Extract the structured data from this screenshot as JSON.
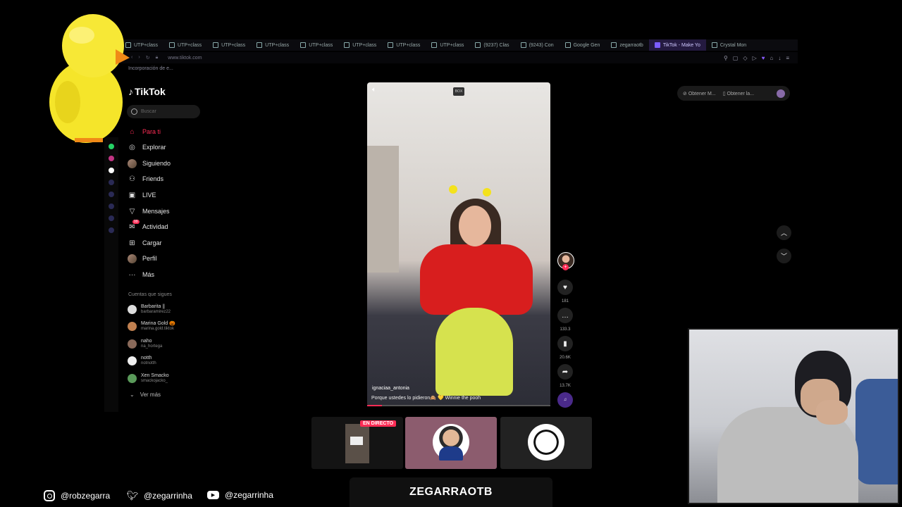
{
  "browser": {
    "tabs": [
      {
        "label": "UTP+class",
        "active": false
      },
      {
        "label": "UTP+class",
        "active": false
      },
      {
        "label": "UTP+class",
        "active": false
      },
      {
        "label": "UTP+class",
        "active": false
      },
      {
        "label": "UTP+class",
        "active": false
      },
      {
        "label": "UTP+class",
        "active": false
      },
      {
        "label": "UTP+class",
        "active": false
      },
      {
        "label": "UTP+class",
        "active": false
      },
      {
        "label": "(9237) Clas",
        "active": false
      },
      {
        "label": "(9243) Con",
        "active": false
      },
      {
        "label": "Google Gen",
        "active": false
      },
      {
        "label": "zegarraotb",
        "active": false
      },
      {
        "label": "TikTok - Make Yo",
        "active": true
      },
      {
        "label": "Crystal Mon",
        "active": false
      }
    ],
    "url": "www.tiktok.com",
    "bookmark": "Incorporación de e..."
  },
  "sidebar": {
    "logo": "TikTok",
    "search_placeholder": "Buscar",
    "nav": [
      {
        "label": "Para ti",
        "icon": "home-icon",
        "active": true
      },
      {
        "label": "Explorar",
        "icon": "compass-icon",
        "active": false
      },
      {
        "label": "Siguiendo",
        "icon": "avatar-icon",
        "active": false
      },
      {
        "label": "Friends",
        "icon": "friends-icon",
        "active": false
      },
      {
        "label": "LIVE",
        "icon": "live-icon",
        "active": false
      },
      {
        "label": "Mensajes",
        "icon": "send-icon",
        "active": false
      },
      {
        "label": "Actividad",
        "icon": "activity-icon",
        "active": false
      },
      {
        "label": "Cargar",
        "icon": "upload-icon",
        "active": false
      },
      {
        "label": "Perfil",
        "icon": "profile-icon",
        "active": false
      },
      {
        "label": "Más",
        "icon": "more-icon",
        "active": false
      }
    ],
    "activity_badge": "99",
    "following_title": "Cuentas que sigues",
    "following": [
      {
        "name": "Barbarita ||",
        "handle": "barbaramirez22"
      },
      {
        "name": "Marina Gold 🎃",
        "handle": "marina.gold.tiktok"
      },
      {
        "name": "naho",
        "handle": "na_hortega"
      },
      {
        "name": "notth",
        "handle": "notnotth"
      },
      {
        "name": "Xen Smacko",
        "handle": "smackojacko_"
      }
    ],
    "see_more": "Ver más"
  },
  "video": {
    "box_tag": "BOX",
    "author": "ignaciaa_antonia",
    "caption": "Porque ustedes lo pidieron🙈 💛 Winnie the pooh",
    "progress": 0.08
  },
  "actions": {
    "likes": "181",
    "comments": "133.3",
    "saves": "20.6K",
    "shares": "13.7K"
  },
  "topbar": {
    "get_app_1": "Obtener M...",
    "get_app_2": "Obtener la..."
  },
  "live_tag": "EN DIRECTO",
  "overlay": {
    "instagram": "@robzegarra",
    "twitter": "@zegarrinha",
    "youtube": "@zegarrinha",
    "brand": "ZEGARRAOTB"
  }
}
